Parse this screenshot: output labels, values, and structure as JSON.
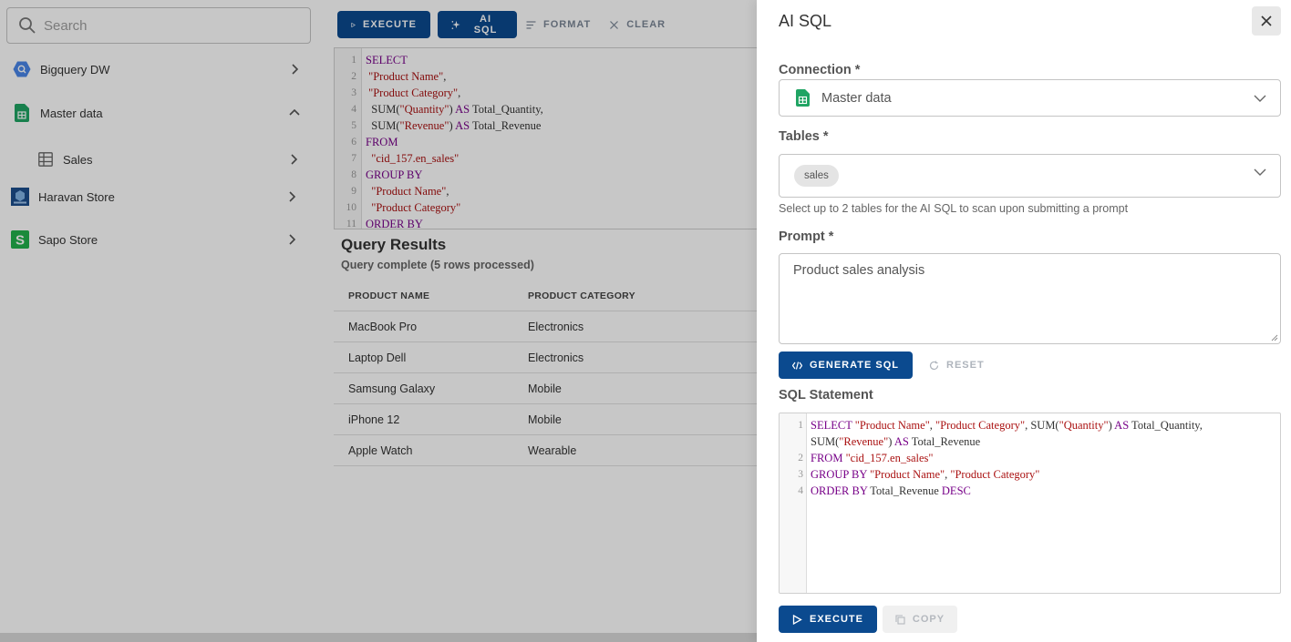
{
  "sidebar": {
    "search_placeholder": "Search",
    "items": [
      {
        "label": "Bigquery DW",
        "icon": "bigquery-icon"
      },
      {
        "label": "Master data",
        "icon": "google-sheets-icon"
      },
      {
        "label": "Sales",
        "icon": "table-icon"
      },
      {
        "label": "Haravan Store",
        "icon": "haravan-icon"
      },
      {
        "label": "Sapo Store",
        "icon": "sapo-icon"
      }
    ]
  },
  "toolbar": {
    "execute": "EXECUTE",
    "ai_sql": "AI SQL",
    "format": "FORMAT",
    "clear": "CLEAR"
  },
  "editor": {
    "line_numbers": [
      "1",
      "2",
      "3",
      "4",
      "5",
      "6",
      "7",
      "8",
      "9",
      "10",
      "11"
    ]
  },
  "results": {
    "title": "Query Results",
    "subtitle": "Query complete (5 rows processed)",
    "columns": [
      "PRODUCT NAME",
      "PRODUCT CATEGORY"
    ],
    "rows": [
      [
        "MacBook Pro",
        "Electronics"
      ],
      [
        "Laptop Dell",
        "Electronics"
      ],
      [
        "Samsung Galaxy",
        "Mobile"
      ],
      [
        "iPhone 12",
        "Mobile"
      ],
      [
        "Apple Watch",
        "Wearable"
      ]
    ]
  },
  "panel": {
    "title": "AI SQL",
    "connection_label": "Connection *",
    "connection_value": "Master data",
    "tables_label": "Tables *",
    "tables_chip": "sales",
    "tables_helper": "Select up to 2 tables for the AI SQL to scan upon submitting a prompt",
    "prompt_label": "Prompt *",
    "prompt_value": "Product sales analysis",
    "generate": "GENERATE SQL",
    "reset": "RESET",
    "sql_label": "SQL Statement",
    "sql_line_numbers": [
      "1",
      "2",
      "3",
      "4"
    ],
    "execute": "EXECUTE",
    "copy": "COPY"
  },
  "colors": {
    "primary": "#0b4a8f",
    "keyword": "#770088",
    "string": "#aa1111",
    "sheets_green": "#1fa463"
  }
}
